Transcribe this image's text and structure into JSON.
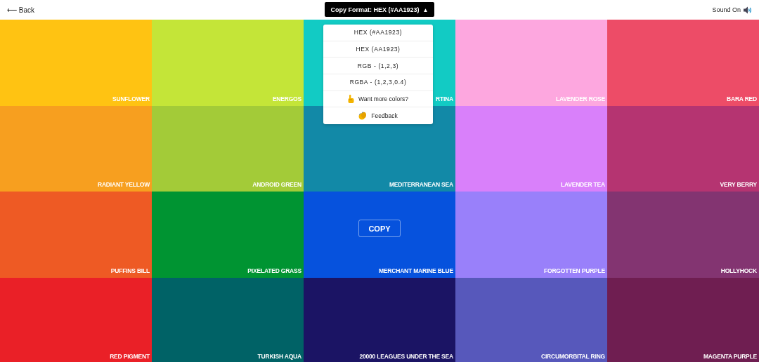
{
  "header": {
    "back": {
      "arrow": "⟵",
      "label": "Back"
    },
    "format_button": {
      "label": "Copy Format: HEX (#AA1923)",
      "caret": "▲",
      "expanded": true
    },
    "sound": {
      "label": "Sound On",
      "on": true
    }
  },
  "format_menu": [
    {
      "kind": "format",
      "label": "HEX (#AA1923)"
    },
    {
      "kind": "format",
      "label": "HEX (AA1923)"
    },
    {
      "kind": "format",
      "label": "RGB - (1,2,3)"
    },
    {
      "kind": "format",
      "label": "RGBA - (1,2,3,0.4)"
    },
    {
      "kind": "more",
      "label": "Want more colors?"
    },
    {
      "kind": "feedback",
      "label": "Feedback"
    }
  ],
  "swatches": [
    {
      "name": "SUNFLOWER",
      "color": "#ffc312"
    },
    {
      "name": "ENERGOS",
      "color": "#c4e538"
    },
    {
      "name": "RTINA",
      "color": "#12cbc4"
    },
    {
      "name": "LAVENDER ROSE",
      "color": "#fda7df"
    },
    {
      "name": "BARA RED",
      "color": "#ed4c67"
    },
    {
      "name": "RADIANT YELLOW",
      "color": "#f79f1f"
    },
    {
      "name": "ANDROID GREEN",
      "color": "#a3cb38"
    },
    {
      "name": "MEDITERRANEAN SEA",
      "color": "#1289a7"
    },
    {
      "name": "LAVENDER TEA",
      "color": "#d980fa"
    },
    {
      "name": "VERY BERRY",
      "color": "#b53471"
    },
    {
      "name": "PUFFINS BILL",
      "color": "#ee5a24"
    },
    {
      "name": "PIXELATED GRASS",
      "color": "#009432"
    },
    {
      "name": "MERCHANT MARINE BLUE",
      "color": "#0652dd",
      "copy_label": "COPY"
    },
    {
      "name": "FORGOTTEN PURPLE",
      "color": "#9980fa"
    },
    {
      "name": "HOLLYHOCK",
      "color": "#833471"
    },
    {
      "name": "RED PIGMENT",
      "color": "#ea2027"
    },
    {
      "name": "TURKISH AQUA",
      "color": "#006266"
    },
    {
      "name": "20000 LEAGUES UNDER THE SEA",
      "color": "#1b1464"
    },
    {
      "name": "CIRCUMORBITAL RING",
      "color": "#5758bb"
    },
    {
      "name": "MAGENTA PURPLE",
      "color": "#6f1e51"
    }
  ]
}
